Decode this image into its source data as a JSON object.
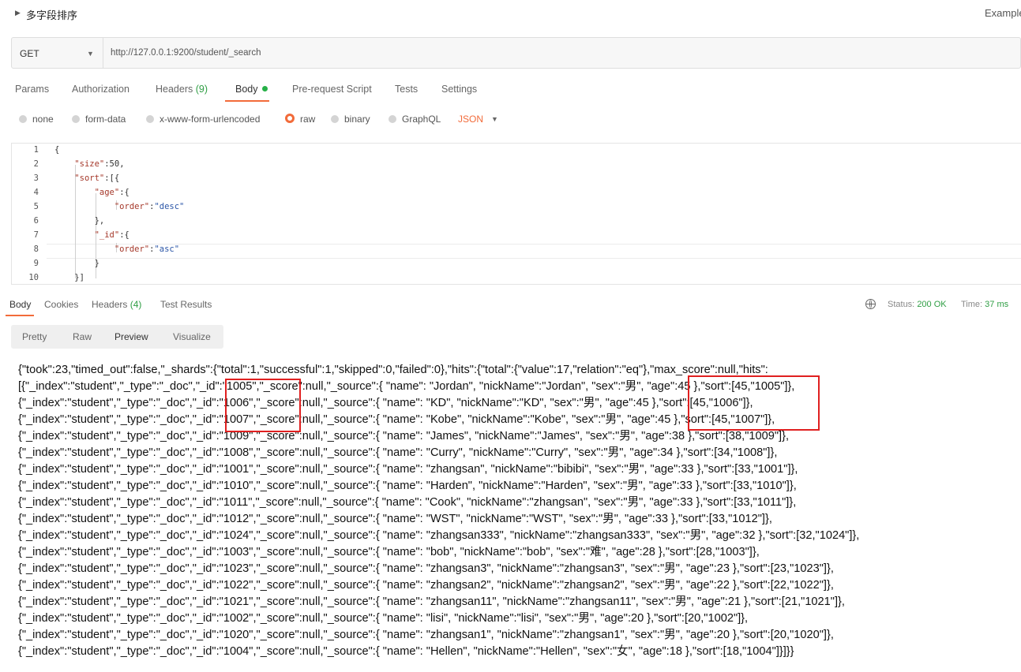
{
  "header": {
    "title": "多字段排序",
    "examples_label": "Examples"
  },
  "request": {
    "method": "GET",
    "url": "http://127.0.0.1:9200/student/_search"
  },
  "request_tabs": {
    "params": "Params",
    "authorization": "Authorization",
    "headers_label": "Headers",
    "headers_count": "(9)",
    "body": "Body",
    "prerequest": "Pre-request Script",
    "tests": "Tests",
    "settings": "Settings"
  },
  "body_options": {
    "none": "none",
    "form_data": "form-data",
    "urlencoded": "x-www-form-urlencoded",
    "raw": "raw",
    "binary": "binary",
    "graphql": "GraphQL",
    "format": "JSON",
    "selected": "raw"
  },
  "editor": {
    "line_numbers": [
      "1",
      "2",
      "3",
      "4",
      "5",
      "6",
      "7",
      "8",
      "9",
      "10"
    ],
    "lines": [
      {
        "indent": "",
        "parts": [
          {
            "t": "p",
            "v": "{"
          }
        ]
      },
      {
        "indent": "    ",
        "parts": [
          {
            "t": "k",
            "v": "\"size\""
          },
          {
            "t": "p",
            "v": ":50,"
          }
        ]
      },
      {
        "indent": "    ",
        "parts": [
          {
            "t": "k",
            "v": "\"sort\""
          },
          {
            "t": "p",
            "v": ":[{"
          }
        ]
      },
      {
        "indent": "        ",
        "parts": [
          {
            "t": "k",
            "v": "\"age\""
          },
          {
            "t": "p",
            "v": ":{"
          }
        ]
      },
      {
        "indent": "            ",
        "parts": [
          {
            "t": "k",
            "v": "\"order\""
          },
          {
            "t": "p",
            "v": ":"
          },
          {
            "t": "s",
            "v": "\"desc\""
          }
        ]
      },
      {
        "indent": "        ",
        "parts": [
          {
            "t": "p",
            "v": "},"
          }
        ]
      },
      {
        "indent": "        ",
        "parts": [
          {
            "t": "k",
            "v": "\"_id\""
          },
          {
            "t": "p",
            "v": ":{"
          }
        ]
      },
      {
        "indent": "            ",
        "parts": [
          {
            "t": "k",
            "v": "\"order\""
          },
          {
            "t": "p",
            "v": ":"
          },
          {
            "t": "s",
            "v": "\"asc\""
          }
        ]
      },
      {
        "indent": "        ",
        "parts": [
          {
            "t": "p",
            "v": "}"
          }
        ]
      },
      {
        "indent": "    ",
        "parts": [
          {
            "t": "p",
            "v": "}]"
          }
        ]
      }
    ]
  },
  "response_tabs": {
    "body": "Body",
    "cookies": "Cookies",
    "headers_label": "Headers",
    "headers_count": "(4)",
    "test_results": "Test Results"
  },
  "response_status": {
    "status_label": "Status:",
    "status_value": "200 OK",
    "time_label": "Time:",
    "time_value": "37 ms"
  },
  "view_modes": {
    "pretty": "Pretty",
    "raw": "Raw",
    "preview": "Preview",
    "visualize": "Visualize",
    "selected": "Preview"
  },
  "response_lines": [
    "{\"took\":23,\"timed_out\":false,\"_shards\":{\"total\":1,\"successful\":1,\"skipped\":0,\"failed\":0},\"hits\":{\"total\":{\"value\":17,\"relation\":\"eq\"},\"max_score\":null,\"hits\":",
    "[{\"_index\":\"student\",\"_type\":\"_doc\",\"_id\":\"1005\",\"_score\":null,\"_source\":{ \"name\": \"Jordan\", \"nickName\":\"Jordan\", \"sex\":\"男\", \"age\":45 },\"sort\":[45,\"1005\"]},",
    "{\"_index\":\"student\",\"_type\":\"_doc\",\"_id\":\"1006\",\"_score\":null,\"_source\":{ \"name\": \"KD\", \"nickName\":\"KD\", \"sex\":\"男\", \"age\":45 },\"sort\":[45,\"1006\"]},",
    "{\"_index\":\"student\",\"_type\":\"_doc\",\"_id\":\"1007\",\"_score\":null,\"_source\":{ \"name\": \"Kobe\", \"nickName\":\"Kobe\", \"sex\":\"男\", \"age\":45 },\"sort\":[45,\"1007\"]},",
    "{\"_index\":\"student\",\"_type\":\"_doc\",\"_id\":\"1009\",\"_score\":null,\"_source\":{ \"name\": \"James\", \"nickName\":\"James\", \"sex\":\"男\", \"age\":38 },\"sort\":[38,\"1009\"]},",
    "{\"_index\":\"student\",\"_type\":\"_doc\",\"_id\":\"1008\",\"_score\":null,\"_source\":{ \"name\": \"Curry\", \"nickName\":\"Curry\", \"sex\":\"男\", \"age\":34 },\"sort\":[34,\"1008\"]},",
    "{\"_index\":\"student\",\"_type\":\"_doc\",\"_id\":\"1001\",\"_score\":null,\"_source\":{ \"name\": \"zhangsan\", \"nickName\":\"bibibi\", \"sex\":\"男\", \"age\":33 },\"sort\":[33,\"1001\"]},",
    "{\"_index\":\"student\",\"_type\":\"_doc\",\"_id\":\"1010\",\"_score\":null,\"_source\":{ \"name\": \"Harden\", \"nickName\":\"Harden\", \"sex\":\"男\", \"age\":33 },\"sort\":[33,\"1010\"]},",
    "{\"_index\":\"student\",\"_type\":\"_doc\",\"_id\":\"1011\",\"_score\":null,\"_source\":{ \"name\": \"Cook\", \"nickName\":\"zhangsan\", \"sex\":\"男\", \"age\":33 },\"sort\":[33,\"1011\"]},",
    "{\"_index\":\"student\",\"_type\":\"_doc\",\"_id\":\"1012\",\"_score\":null,\"_source\":{ \"name\": \"WST\", \"nickName\":\"WST\", \"sex\":\"男\", \"age\":33 },\"sort\":[33,\"1012\"]},",
    "{\"_index\":\"student\",\"_type\":\"_doc\",\"_id\":\"1024\",\"_score\":null,\"_source\":{ \"name\": \"zhangsan333\", \"nickName\":\"zhangsan333\", \"sex\":\"男\", \"age\":32 },\"sort\":[32,\"1024\"]},",
    "{\"_index\":\"student\",\"_type\":\"_doc\",\"_id\":\"1003\",\"_score\":null,\"_source\":{ \"name\": \"bob\", \"nickName\":\"bob\", \"sex\":\"难\", \"age\":28 },\"sort\":[28,\"1003\"]},",
    "{\"_index\":\"student\",\"_type\":\"_doc\",\"_id\":\"1023\",\"_score\":null,\"_source\":{ \"name\": \"zhangsan3\", \"nickName\":\"zhangsan3\", \"sex\":\"男\", \"age\":23 },\"sort\":[23,\"1023\"]},",
    "{\"_index\":\"student\",\"_type\":\"_doc\",\"_id\":\"1022\",\"_score\":null,\"_source\":{ \"name\": \"zhangsan2\", \"nickName\":\"zhangsan2\", \"sex\":\"男\", \"age\":22 },\"sort\":[22,\"1022\"]},",
    "{\"_index\":\"student\",\"_type\":\"_doc\",\"_id\":\"1021\",\"_score\":null,\"_source\":{ \"name\": \"zhangsan11\", \"nickName\":\"zhangsan11\", \"sex\":\"男\", \"age\":21 },\"sort\":[21,\"1021\"]},",
    "{\"_index\":\"student\",\"_type\":\"_doc\",\"_id\":\"1002\",\"_score\":null,\"_source\":{ \"name\": \"lisi\", \"nickName\":\"lisi\", \"sex\":\"男\", \"age\":20 },\"sort\":[20,\"1002\"]},",
    "{\"_index\":\"student\",\"_type\":\"_doc\",\"_id\":\"1020\",\"_score\":null,\"_source\":{ \"name\": \"zhangsan1\", \"nickName\":\"zhangsan1\", \"sex\":\"男\", \"age\":20 },\"sort\":[20,\"1020\"]},",
    "{\"_index\":\"student\",\"_type\":\"_doc\",\"_id\":\"1004\",\"_score\":null,\"_source\":{ \"name\": \"Hellen\", \"nickName\":\"Hellen\", \"sex\":\"女\", \"age\":18 },\"sort\":[18,\"1004\"]}]}}"
  ],
  "colors": {
    "accent": "#f26b3a",
    "success": "#2f9e44",
    "highlight_box": "#e02020"
  }
}
